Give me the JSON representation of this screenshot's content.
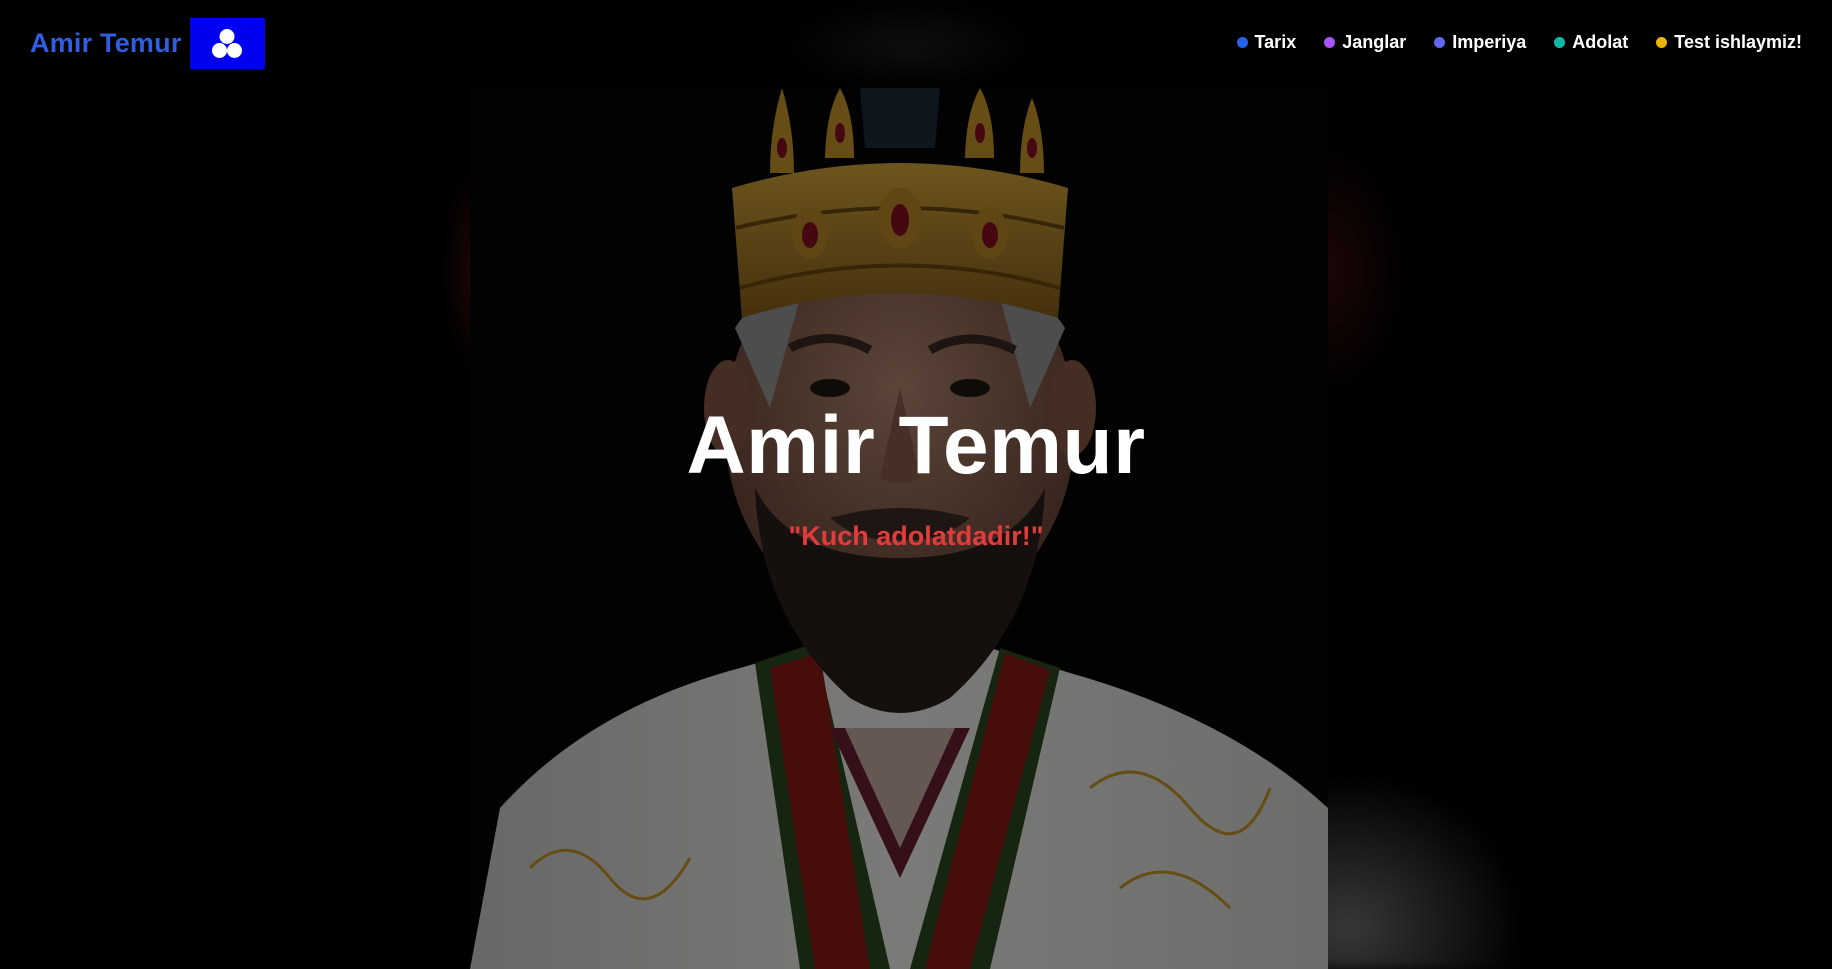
{
  "header": {
    "brand_text": "Amir Temur",
    "brand_logo_icon": "three-circles-icon",
    "brand_color": "#2f5fe0",
    "logo_bg_color": "#0000f0"
  },
  "nav": {
    "items": [
      {
        "label": "Tarix",
        "dot_color": "#2563eb"
      },
      {
        "label": "Janglar",
        "dot_color": "#a855f7"
      },
      {
        "label": "Imperiya",
        "dot_color": "#6366f1"
      },
      {
        "label": "Adolat",
        "dot_color": "#14b8a6"
      },
      {
        "label": "Test ishlaymiz!",
        "dot_color": "#eab308"
      }
    ]
  },
  "hero": {
    "title": "Amir Temur",
    "subtitle": "\"Kuch adolatdadir!\"",
    "subtitle_color": "#e23b3b",
    "background": "crowned-ruler-portrait"
  }
}
